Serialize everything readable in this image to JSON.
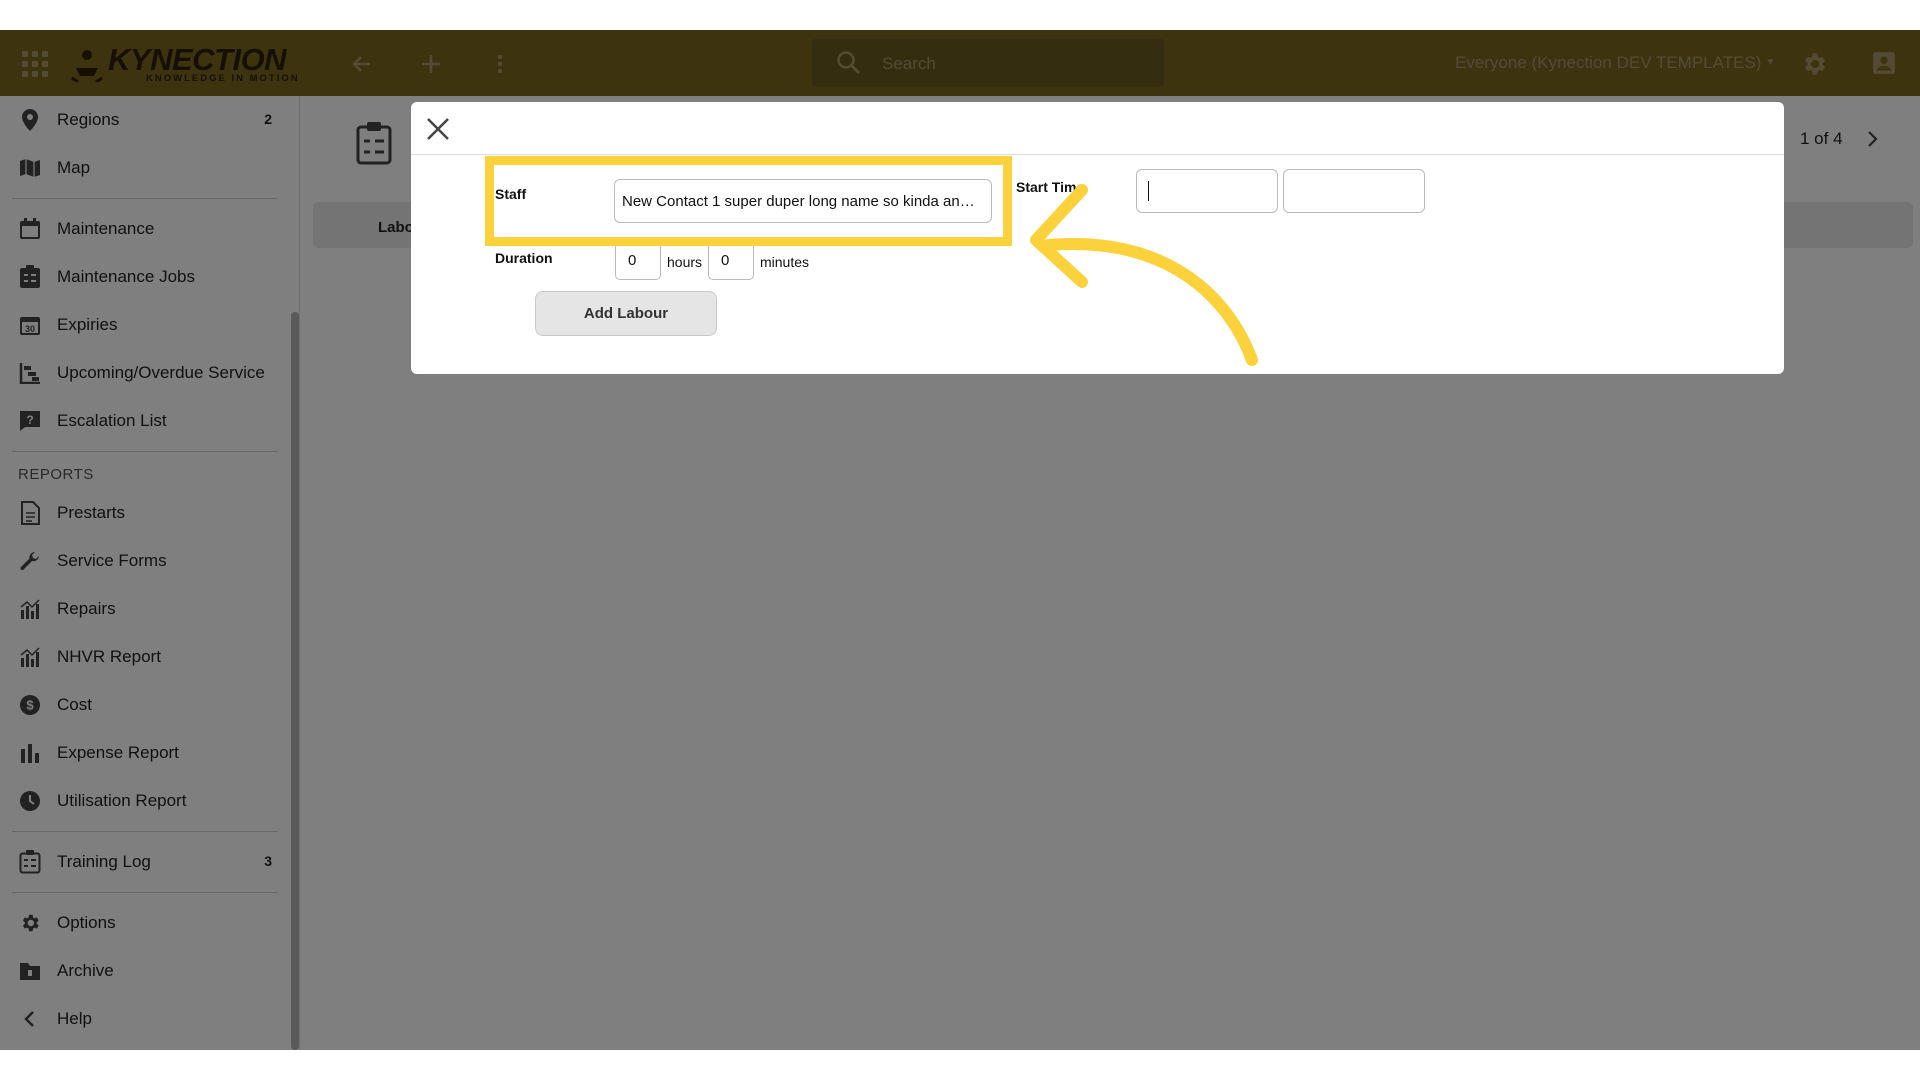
{
  "topbar": {
    "brand": "KYNECTION",
    "tagline": "KNOWLEDGE IN MOTION",
    "search_placeholder": "Search",
    "account": "Everyone (Kynection DEV TEMPLATES)",
    "icons": [
      "apps-grid-icon",
      "back-arrow-icon",
      "plus-icon",
      "more-vert-icon",
      "search-icon",
      "gear-icon",
      "account-icon"
    ]
  },
  "sidebar": {
    "items_top": [
      {
        "label": "Regions",
        "count": "2",
        "icon": "pin-icon"
      },
      {
        "label": "Map",
        "icon": "map-icon"
      }
    ],
    "items_maint": [
      {
        "label": "Maintenance",
        "icon": "calendar-icon"
      },
      {
        "label": "Maintenance Jobs",
        "icon": "clipboard-icon"
      },
      {
        "label": "Expiries",
        "icon": "calendar-30-icon"
      },
      {
        "label": "Upcoming/Overdue Service",
        "icon": "gantt-icon"
      },
      {
        "label": "Escalation List",
        "icon": "question-icon"
      }
    ],
    "reports_heading": "REPORTS",
    "items_reports": [
      {
        "label": "Prestarts",
        "icon": "document-icon"
      },
      {
        "label": "Service Forms",
        "icon": "wrench-icon"
      },
      {
        "label": "Repairs",
        "icon": "chart-icon"
      },
      {
        "label": "NHVR Report",
        "icon": "chart-icon"
      },
      {
        "label": "Cost",
        "icon": "dollar-icon"
      },
      {
        "label": "Expense Report",
        "icon": "bar-chart-icon"
      },
      {
        "label": "Utilisation Report",
        "icon": "clock-icon"
      }
    ],
    "items_training": [
      {
        "label": "Training Log",
        "count": "3",
        "icon": "clipboard-icon"
      }
    ],
    "items_bottom": [
      {
        "label": "Options",
        "icon": "gear-icon"
      },
      {
        "label": "Archive",
        "icon": "archive-icon"
      },
      {
        "label": "Help",
        "icon": "chevron-left-icon"
      }
    ]
  },
  "main": {
    "tab_label": "Labo",
    "pager": "1 of 4"
  },
  "modal": {
    "staff_label": "Staff",
    "staff_value": "New Contact 1 super duper long name so kinda an…",
    "start_time_label": "Start Time",
    "duration_label": "Duration",
    "hours_value": "0",
    "hours_unit": "hours",
    "minutes_value": "0",
    "minutes_unit": "minutes",
    "add_button": "Add Labour"
  },
  "colors": {
    "topbar": "#7c661f",
    "highlight": "#fbd13c",
    "overlay": "rgba(0,0,0,0.5)"
  }
}
